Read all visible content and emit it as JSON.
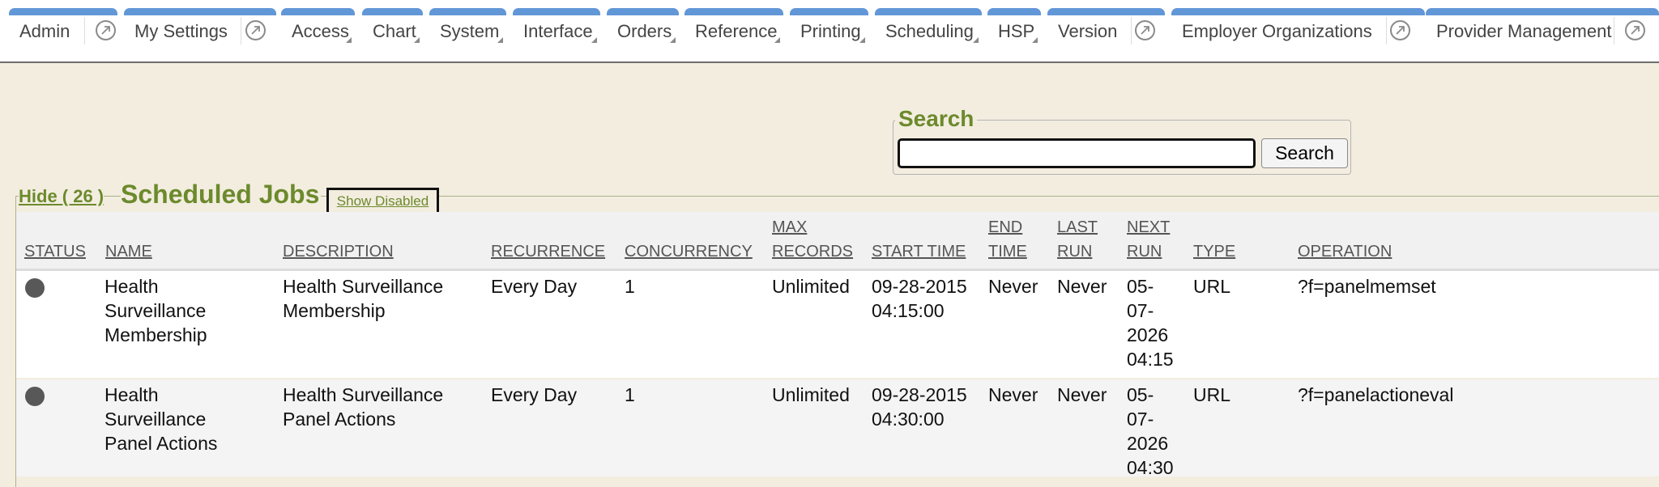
{
  "nav": {
    "tabs": [
      {
        "label": "Admin",
        "kind": "ext"
      },
      {
        "label": "My Settings",
        "kind": "ext"
      },
      {
        "label": "Access",
        "kind": "menu"
      },
      {
        "label": "Chart",
        "kind": "menu"
      },
      {
        "label": "System",
        "kind": "menu"
      },
      {
        "label": "Interface",
        "kind": "menu"
      },
      {
        "label": "Orders",
        "kind": "menu"
      },
      {
        "label": "Reference",
        "kind": "menu"
      },
      {
        "label": "Printing",
        "kind": "menu"
      },
      {
        "label": "Scheduling",
        "kind": "menu"
      },
      {
        "label": "HSP",
        "kind": "menu"
      },
      {
        "label": "Version",
        "kind": "ext"
      },
      {
        "label": "Employer Organizations",
        "kind": "ext"
      },
      {
        "label": "Provider Management",
        "kind": "ext"
      }
    ],
    "accent_color": "#6297d7"
  },
  "search": {
    "legend": "Search",
    "value": "",
    "button_label": "Search"
  },
  "jobs": {
    "hide_label": "Hide ( 26 )",
    "title": "Scheduled Jobs",
    "show_disabled_label": "Show Disabled",
    "title_color": "#6c8a2c",
    "columns": {
      "status": "STATUS",
      "name": "NAME",
      "description": "DESCRIPTION",
      "recurrence": "RECURRENCE",
      "concurrency": "CONCURRENCY",
      "max_records": [
        "MAX",
        "RECORDS"
      ],
      "start_time": "START TIME",
      "end_time": [
        "END",
        "TIME"
      ],
      "last_run": [
        "LAST",
        "RUN"
      ],
      "next_run": [
        "NEXT",
        "RUN"
      ],
      "type": "TYPE",
      "operation": "OPERATION"
    },
    "rows": [
      {
        "status": "inactive",
        "name": [
          "Health",
          "Surveillance",
          "Membership"
        ],
        "description": [
          "Health Surveillance",
          "Membership"
        ],
        "recurrence": "Every Day",
        "concurrency": "1",
        "max_records": "Unlimited",
        "start_time": [
          "09-28-2015",
          "04:15:00"
        ],
        "end_time": "Never",
        "last_run": "Never",
        "next_run": [
          "05-",
          "07-",
          "2026",
          "04:15"
        ],
        "type": "URL",
        "operation": "?f=panelmemset"
      },
      {
        "status": "inactive",
        "name": [
          "Health",
          "Surveillance",
          "Panel Actions"
        ],
        "description": [
          "Health Surveillance",
          "Panel Actions"
        ],
        "recurrence": "Every Day",
        "concurrency": "1",
        "max_records": "Unlimited",
        "start_time": [
          "09-28-2015",
          "04:30:00"
        ],
        "end_time": "Never",
        "last_run": "Never",
        "next_run": [
          "05-",
          "07-",
          "2026",
          "04:30"
        ],
        "type": "URL",
        "operation": "?f=panelactioneval"
      }
    ]
  }
}
